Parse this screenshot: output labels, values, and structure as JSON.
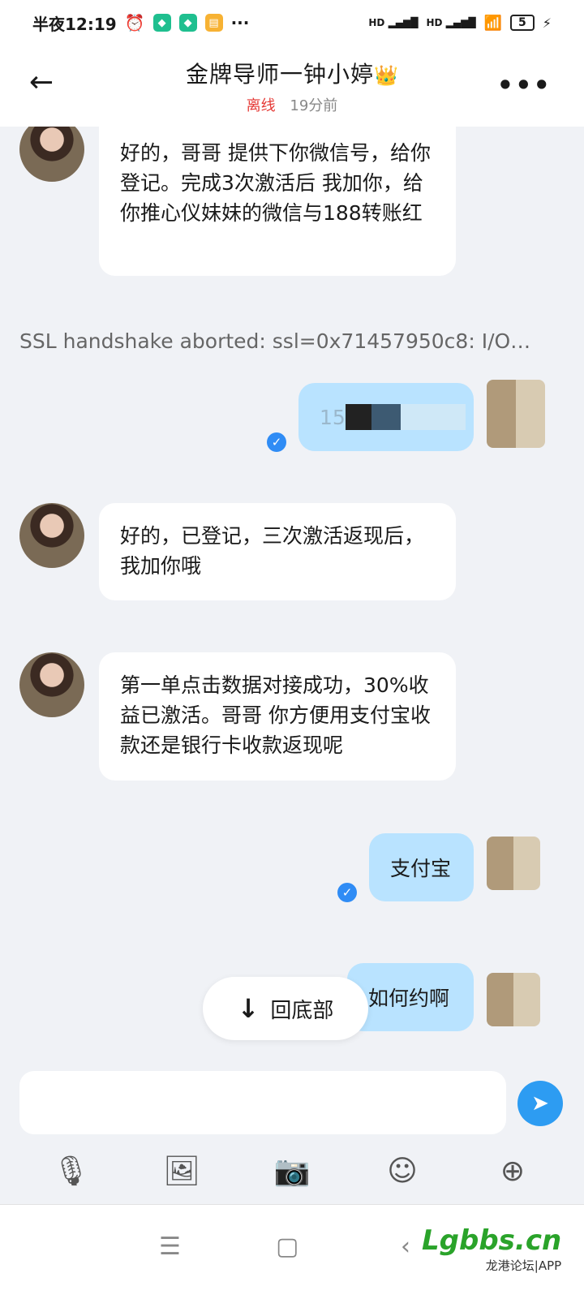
{
  "status_bar": {
    "time": "半夜12:19",
    "net1": "HD",
    "net2": "HD",
    "battery": "5"
  },
  "header": {
    "back_icon": "arrow-left-icon",
    "title": "金牌导师一钟小婷",
    "crown": "👑",
    "status_offline": "离线",
    "last_seen": "19分前",
    "more_icon": "more-horizontal-icon"
  },
  "messages": [
    {
      "side": "left",
      "text": "好的，哥哥 提供下你微信号，给你登记。完成3次激活后 我加你，给你推心仪妹妹的微信与188转账红"
    },
    {
      "side": "system",
      "text": "SSL handshake aborted: ssl=0x71457950c8: I/O…"
    },
    {
      "side": "right",
      "text": "15"
    },
    {
      "side": "left",
      "text": "好的，已登记，三次激活返现后，我加你哦"
    },
    {
      "side": "left",
      "text": "第一单点击数据对接成功，30%收益已激活。哥哥 你方便用支付宝收款还是银行卡收款返现呢"
    },
    {
      "side": "right",
      "text": "支付宝"
    },
    {
      "side": "right",
      "text": "如何约啊"
    }
  ],
  "scroll_to_bottom": {
    "label": "回底部"
  },
  "composer": {
    "placeholder": "",
    "tools": [
      "microphone-icon",
      "image-icon",
      "camera-icon",
      "emoji-icon",
      "plus-icon"
    ],
    "send_icon": "send-icon"
  },
  "watermark": {
    "main": "Lgbbs.cn",
    "sub": "龙港论坛|APP"
  },
  "colors": {
    "bubble_in": "#ffffff",
    "bubble_out": "#b9e3ff",
    "accent": "#2d9cf2",
    "offline": "#e53935"
  }
}
